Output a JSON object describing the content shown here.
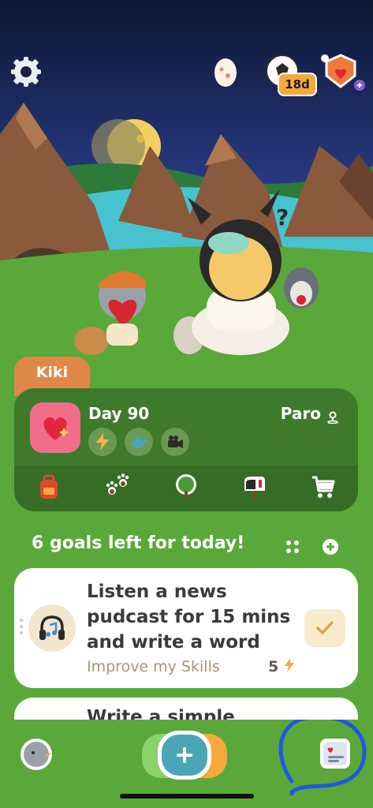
{
  "header": {
    "streak_badge": "18d",
    "icons": [
      "gear-icon",
      "egg-icon",
      "soccer-ball-icon",
      "heart-shield-icon"
    ]
  },
  "pet": {
    "name": "Kiki"
  },
  "status": {
    "day_label": "Day 90",
    "companion_name": "Paro",
    "nav_icons": [
      "backpack-icon",
      "paw-prints-icon",
      "tree-icon",
      "mailbox-icon",
      "cart-icon"
    ]
  },
  "goals": {
    "header": "6 goals left for today!",
    "items": [
      {
        "title": "Listen a news pudcast for 15 mins and write a word",
        "category": "Improve my Skills",
        "points": "5",
        "icon": "headphones-music-icon"
      },
      {
        "title": "Write a simple"
      }
    ]
  },
  "colors": {
    "grass": "#5aa83a",
    "card_dark": "#3f7a2c",
    "tab": "#e0874a",
    "accent_teal": "#4aa6b6",
    "heart_pink": "#f06e8c"
  }
}
